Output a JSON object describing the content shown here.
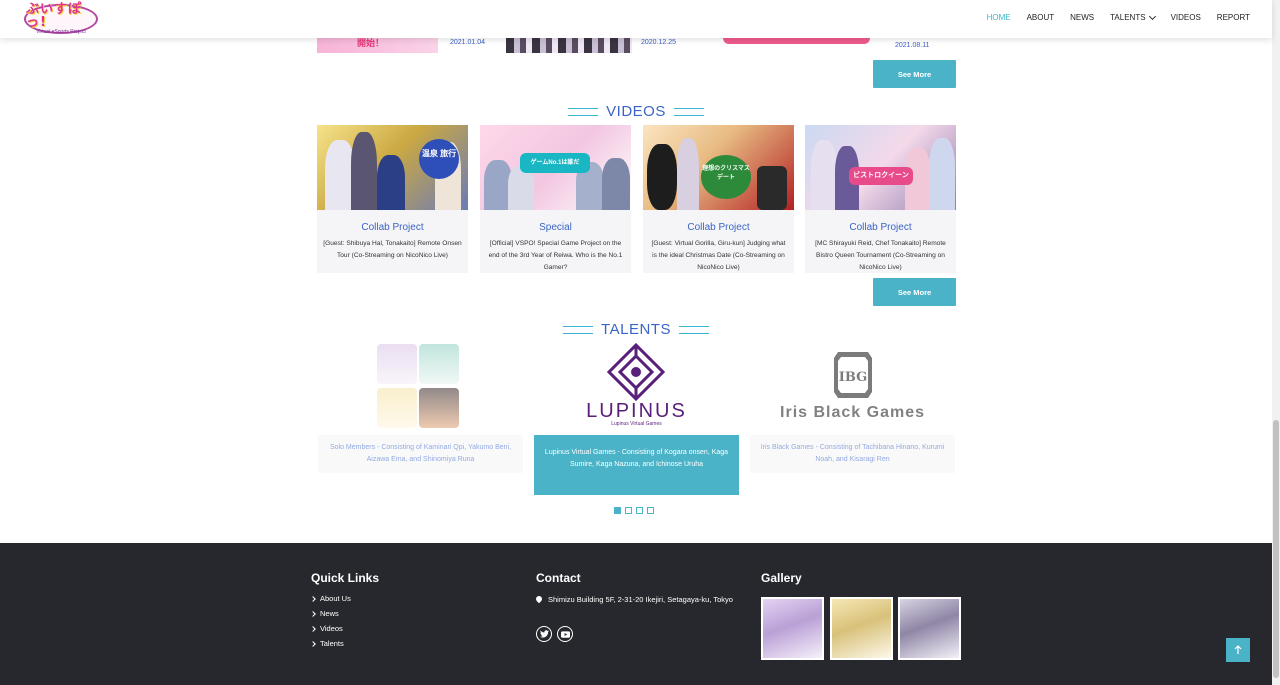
{
  "header": {
    "logo_text": "ぶいすぽっ!",
    "logo_sub": "Virtual eSports Project",
    "nav": [
      {
        "label": "HOME"
      },
      {
        "label": "ABOUT"
      },
      {
        "label": "NEWS"
      },
      {
        "label": "TALENTS"
      },
      {
        "label": "VIDEOS"
      },
      {
        "label": "REPORT"
      }
    ]
  },
  "news": {
    "items": [
      {
        "thumb_text": "開始！",
        "date": "2021.01.04"
      },
      {
        "thumb_text": "",
        "date": "2020.12.25"
      },
      {
        "thumb_text": "",
        "date": "2021.08.11"
      }
    ],
    "see_more": "See More"
  },
  "videos": {
    "heading": "VIDEOS",
    "items": [
      {
        "title": "Collab Project",
        "desc": "[Guest: Shibuya Hal, Tonakaito] Remote Onsen Tour (Co-Streaming on NicoNico Live)",
        "thumb_text": "温泉 旅行"
      },
      {
        "title": "Special",
        "desc": "[Official] VSPO! Special Game Project on the end of the 3rd Year of Reiwa. Who is the No.1 Gamer?",
        "thumb_text": "ゲームNo.1は誰だ"
      },
      {
        "title": "Collab Project",
        "desc": "[Guest: Virtual Gorilla, Giru-kun] Judging what is the ideal Christmas Date (Co-Streaming on NicoNico Live)",
        "thumb_text": "理想のクリスマスデート"
      },
      {
        "title": "Collab Project",
        "desc": "[MC Shirayuki Reid, Chef Tonakaito] Remote Bistro Queen Tournament (Co-Streaming on NicoNico Live)",
        "thumb_text": "ビストロクイーン"
      }
    ],
    "see_more": "See More"
  },
  "talents": {
    "heading": "TALENTS",
    "items": [
      {
        "name": "Solo Members",
        "desc": " - Consisting of Kaminari Qpi, Yakumo Beni, Aizawa Ema, and Shinomiya Runa"
      },
      {
        "name": "Lupinus Virtual Games",
        "desc": " - Consisting of Kogara onsen, Kaga Sumire, Kaga Nazuna, and Ichinose Uruha",
        "logo_text": "LUPINUS",
        "logo_sub": "Lupinus Virtual Games"
      },
      {
        "name": "Iris Black Games",
        "desc": " - Consisting of Tachibana Hinano, Kurumi Noah, and Kisaragi Ren",
        "logo_text": "Iris Black Games",
        "logo_mark": "IBG"
      }
    ],
    "carousel": {
      "pages": 4,
      "active": 1
    }
  },
  "footer": {
    "quick_links_heading": "Quick Links",
    "quick_links": [
      "About Us",
      "News",
      "Videos",
      "Talents"
    ],
    "contact_heading": "Contact",
    "address": "Shimizu Building 5F, 2-31-20 Ikejiri, Setagaya-ku, Tokyo",
    "social": [
      "twitter-icon",
      "youtube-icon"
    ],
    "gallery_heading": "Gallery"
  },
  "colors": {
    "accent": "#4bb3c8",
    "link_blue": "#3a64c8",
    "footer_bg": "#26282d"
  }
}
